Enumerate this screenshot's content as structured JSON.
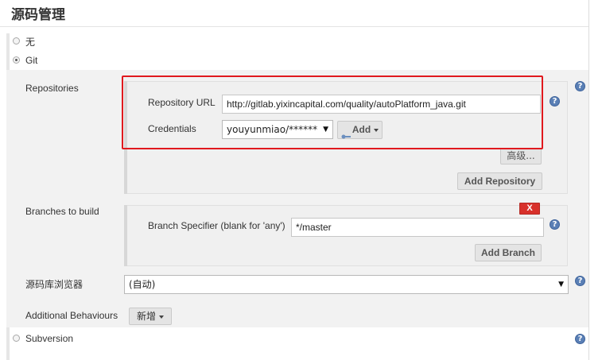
{
  "section": {
    "title": "源码管理"
  },
  "scm_options": [
    {
      "label": "无",
      "selected": false
    },
    {
      "label": "Git",
      "selected": true
    },
    {
      "label": "Subversion",
      "selected": false
    }
  ],
  "repositories": {
    "label": "Repositories",
    "url_label": "Repository URL",
    "url_value": "http://gitlab.yixincapital.com/quality/autoPlatform_java.git",
    "credentials_label": "Credentials",
    "credentials_value": "youyunmiao/******",
    "add_label": "Add",
    "advanced_label": "高级...",
    "add_repository_label": "Add Repository"
  },
  "branches": {
    "label": "Branches to build",
    "specifier_label": "Branch Specifier (blank for 'any')",
    "specifier_value": "*/master",
    "delete_label": "X",
    "add_branch_label": "Add Branch"
  },
  "browser": {
    "label": "源码库浏览器",
    "value": "(自动)"
  },
  "behaviours": {
    "label": "Additional Behaviours",
    "add_label": "新增"
  },
  "help_glyph": "?",
  "colors": {
    "highlight": "#e0191e",
    "help": "#5a7fb5",
    "delete": "#d8312b"
  }
}
